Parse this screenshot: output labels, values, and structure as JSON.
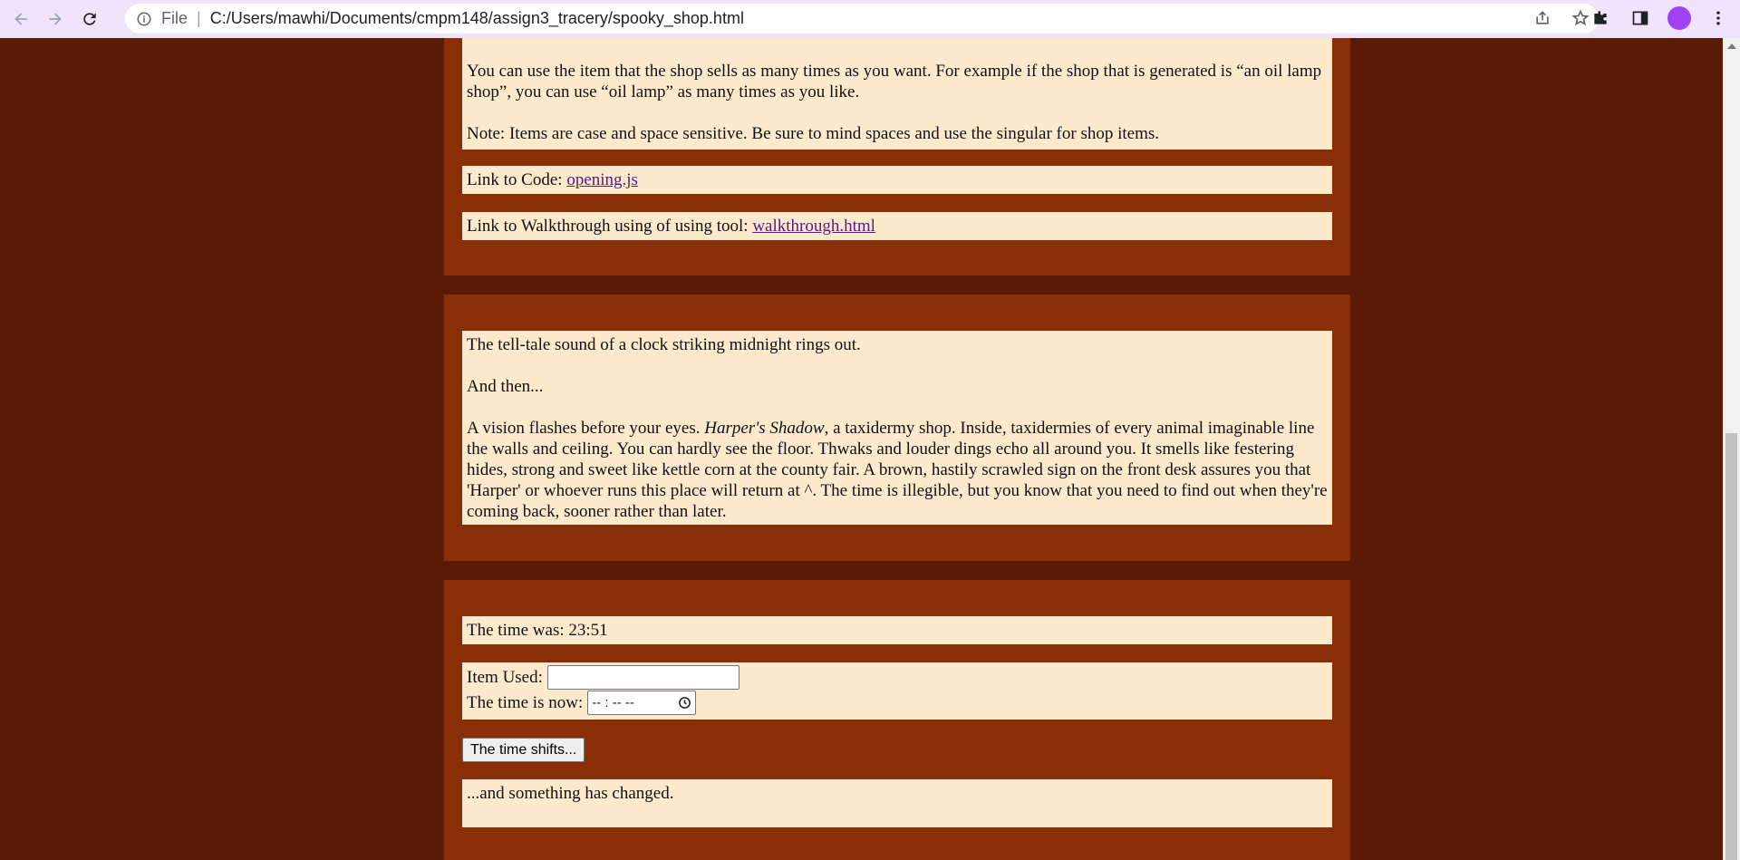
{
  "browser": {
    "scheme_label": "File",
    "url": "C:/Users/mawhi/Documents/cmpm148/assign3_tracery/spooky_shop.html"
  },
  "instructions": {
    "reuse_text": "You can use the item that the shop sells as many times as you want. For example if the shop that is generated is “an oil lamp shop”, you can use “oil lamp” as many times as you like.",
    "note_text": "Note: Items are case and space sensitive. Be sure to mind spaces and use the singular for shop items.",
    "code_link_prefix": "Link to Code:",
    "code_link_text": "opening.js",
    "walkthrough_prefix": "Link to Walkthrough using of using tool:",
    "walkthrough_link_text": "walkthrough.html"
  },
  "story": {
    "line1": "The tell-tale sound of a clock striking midnight rings out.",
    "line2": "And then...",
    "vision_prefix": "A vision flashes before your eyes.",
    "shop_name": "Harper's Shadow",
    "vision_rest": ", a taxidermy shop. Inside, taxidermies of every animal imaginable line the walls and ceiling. You can hardly see the floor. Thwaks and louder dings echo all around you. It smells like festering hides, strong and sweet like kettle corn at the county fair. A brown, hastily scrawled sign on the front desk assures you that 'Harper' or whoever runs this place will return at ^. The time is illegible, but you know that you need to find out when they're coming back, sooner rather than later."
  },
  "game": {
    "time_was": "The time was: 23:51",
    "item_label": "Item Used:",
    "item_value": "",
    "time_now_label": "The time is now:",
    "time_placeholder": "-- : --   --",
    "shift_button": "The time shifts...",
    "result_text": "...and something has changed."
  }
}
